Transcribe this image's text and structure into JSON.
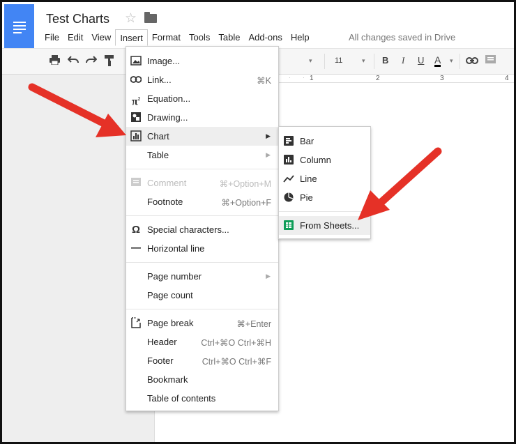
{
  "header": {
    "doc_title": "Test Charts",
    "saved_status": "All changes saved in Drive"
  },
  "menubar": {
    "items": [
      "File",
      "Edit",
      "View",
      "Insert",
      "Format",
      "Tools",
      "Table",
      "Add-ons",
      "Help"
    ],
    "active": "Insert"
  },
  "toolbar": {
    "font_size": "11"
  },
  "ruler": {
    "ticks": [
      "1",
      "2",
      "3",
      "4"
    ]
  },
  "insert_menu": {
    "items": [
      {
        "label": "Image...",
        "icon": "image-icon"
      },
      {
        "label": "Link...",
        "shortcut": "⌘K",
        "icon": "link-icon"
      },
      {
        "label": "Equation...",
        "icon": "pi-icon"
      },
      {
        "label": "Drawing...",
        "icon": "drawing-icon"
      },
      {
        "label": "Chart",
        "icon": "chart-icon",
        "submenu": true,
        "highlighted": true
      },
      {
        "label": "Table",
        "submenu": true
      },
      {
        "label": "Comment",
        "shortcut": "⌘+Option+M",
        "icon": "comment-icon",
        "disabled": true
      },
      {
        "label": "Footnote",
        "shortcut": "⌘+Option+F"
      },
      {
        "label": "Special characters...",
        "icon": "omega-icon"
      },
      {
        "label": "Horizontal line",
        "icon": "horizontal-line-icon"
      },
      {
        "label": "Page number",
        "submenu": true
      },
      {
        "label": "Page count"
      },
      {
        "label": "Page break",
        "shortcut": "⌘+Enter",
        "icon": "page-break-icon"
      },
      {
        "label": "Header",
        "shortcut": "Ctrl+⌘O Ctrl+⌘H"
      },
      {
        "label": "Footer",
        "shortcut": "Ctrl+⌘O Ctrl+⌘F"
      },
      {
        "label": "Bookmark"
      },
      {
        "label": "Table of contents"
      }
    ]
  },
  "chart_submenu": {
    "items": [
      {
        "label": "Bar",
        "icon": "bar-chart-icon"
      },
      {
        "label": "Column",
        "icon": "column-chart-icon"
      },
      {
        "label": "Line",
        "icon": "line-chart-icon"
      },
      {
        "label": "Pie",
        "icon": "pie-chart-icon"
      },
      {
        "label": "From Sheets...",
        "icon": "sheets-icon",
        "highlighted": true
      }
    ]
  },
  "colors": {
    "docs_blue": "#4285f4",
    "sheets_green": "#0f9d58",
    "arrow_red": "#e53127"
  }
}
